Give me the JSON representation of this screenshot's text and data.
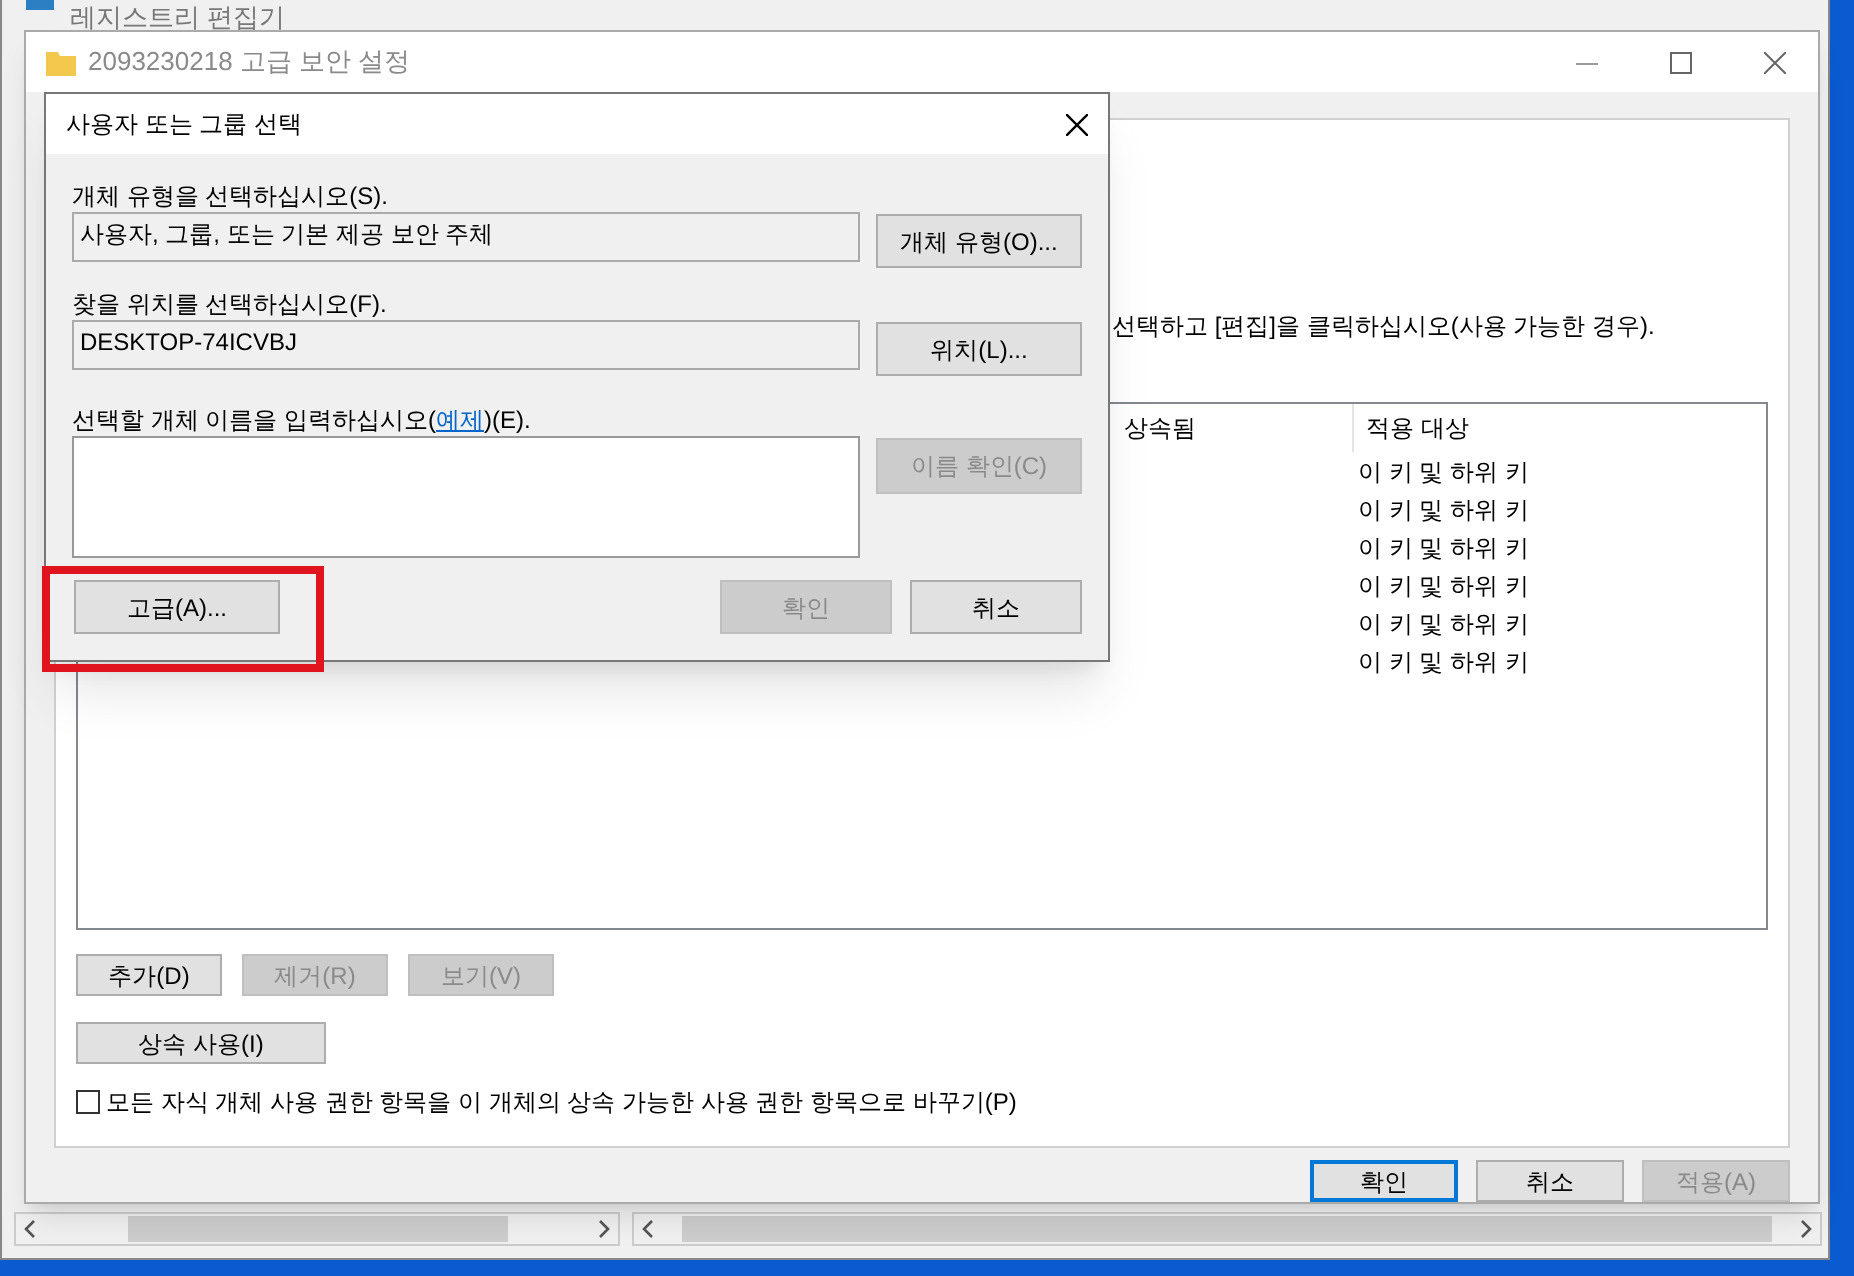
{
  "background_window": {
    "title": "레지스트리 편집기"
  },
  "security_window": {
    "title": "2093230218 고급 보안 설정",
    "instruction": "선택하고 [편집]을 클릭하십시오(사용 가능한 경우).",
    "table": {
      "columns": [
        "상속됨",
        "적용 대상"
      ],
      "rows": [
        {
          "applies_to": "이 키 및 하위 키"
        },
        {
          "applies_to": "이 키 및 하위 키"
        },
        {
          "applies_to": "이 키 및 하위 키"
        },
        {
          "applies_to": "이 키 및 하위 키"
        },
        {
          "applies_to": "이 키 및 하위 키"
        },
        {
          "applies_to": "이 키 및 하위 키"
        }
      ]
    },
    "buttons": [
      {
        "label": "추가(D)",
        "disabled": false
      },
      {
        "label": "제거(R)",
        "disabled": true
      },
      {
        "label": "보기(V)",
        "disabled": true
      }
    ],
    "inherit_button": {
      "label": "상속 사용(I)",
      "disabled": false
    },
    "replace_checkbox": {
      "label": "모든 자식 개체 사용 권한 항목을 이 개체의 상속 가능한 사용 권한 항목으로 바꾸기(P)",
      "checked": false
    },
    "footer_buttons": [
      {
        "label": "확인",
        "disabled": false,
        "default": true
      },
      {
        "label": "취소",
        "disabled": false,
        "default": false
      },
      {
        "label": "적용(A)",
        "disabled": true,
        "default": false
      }
    ]
  },
  "select_dialog": {
    "title": "사용자 또는 그룹 선택",
    "object_type": {
      "label": "개체 유형을 선택하십시오(S).",
      "value": "사용자, 그룹, 또는 기본 제공 보안 주체",
      "button": {
        "label": "개체 유형(O)...",
        "disabled": false
      }
    },
    "location": {
      "label": "찾을 위치를 선택하십시오(F).",
      "value": "DESKTOP-74ICVBJ",
      "button": {
        "label": "위치(L)...",
        "disabled": false
      }
    },
    "names": {
      "label_before": "선택할 개체 이름을 입력하십시오(",
      "link": "예제",
      "label_after": ")(E).",
      "button": {
        "label": "이름 확인(C)",
        "disabled": true
      }
    },
    "advanced_button": {
      "label": "고급(A)...",
      "disabled": false,
      "highlighted": true
    },
    "footer_buttons": [
      {
        "label": "확인",
        "disabled": true
      },
      {
        "label": "취소",
        "disabled": false
      }
    ]
  }
}
